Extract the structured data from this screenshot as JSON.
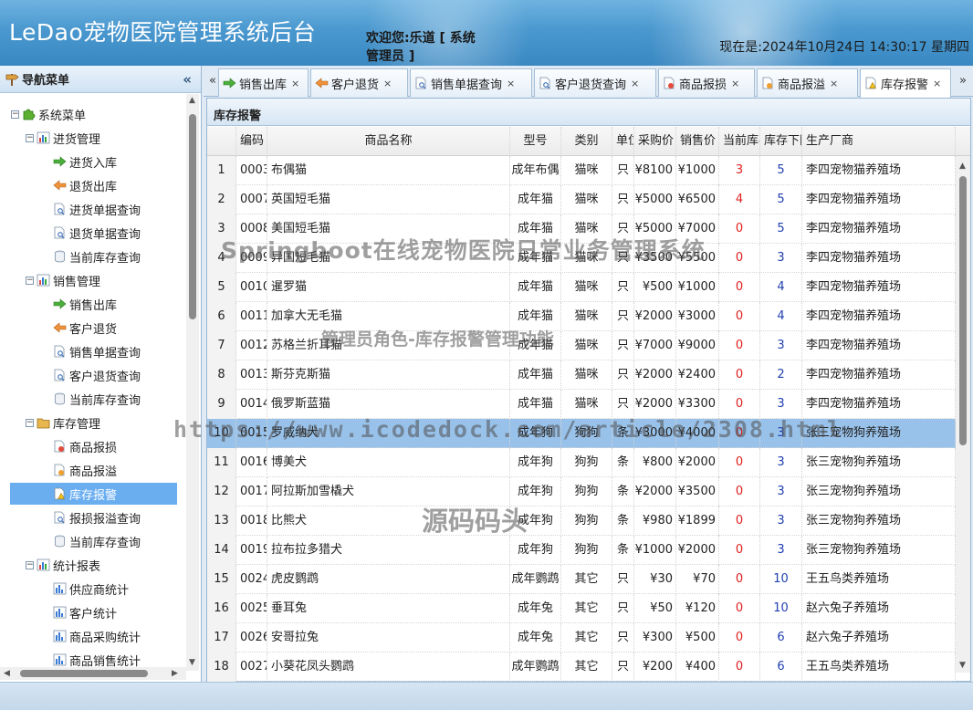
{
  "header": {
    "app_title": "LeDao宠物医院管理系统后台",
    "welcome": "欢迎您:乐道 [ 系统管理员 ]",
    "datetime": "现在是:2024年10月24日 14:30:17 星期四"
  },
  "sidebar": {
    "title": "导航菜单",
    "collapse_icon": "«",
    "root": "系统菜单",
    "groups": [
      {
        "label": "进货管理",
        "items": [
          "进货入库",
          "退货出库",
          "进货单据查询",
          "退货单据查询",
          "当前库存查询"
        ]
      },
      {
        "label": "销售管理",
        "items": [
          "销售出库",
          "客户退货",
          "销售单据查询",
          "客户退货查询",
          "当前库存查询"
        ]
      },
      {
        "label": "库存管理",
        "items": [
          "商品报损",
          "商品报溢",
          "库存报警",
          "报损报溢查询",
          "当前库存查询"
        ]
      },
      {
        "label": "统计报表",
        "items": [
          "供应商统计",
          "客户统计",
          "商品采购统计",
          "商品销售统计"
        ]
      }
    ],
    "selected_item": "库存报警"
  },
  "tabs": {
    "items": [
      "销售出库",
      "客户退货",
      "销售单据查询",
      "客户退货查询",
      "商品报损",
      "商品报溢",
      "库存报警"
    ],
    "active": "库存报警",
    "close_glyph": "×",
    "prev_glyph": "«",
    "next_glyph": "»"
  },
  "panel": {
    "title": "库存报警",
    "columns": [
      "编码",
      "商品名称",
      "型号",
      "类别",
      "单位",
      "采购价",
      "销售价",
      "当前库存",
      "库存下限",
      "生产厂商"
    ],
    "rows": [
      [
        "1",
        "0003",
        "布偶猫",
        "成年布偶",
        "猫咪",
        "只",
        "¥8100",
        "¥1000",
        "3",
        "5",
        "李四宠物猫养殖场"
      ],
      [
        "2",
        "0007",
        "英国短毛猫",
        "成年猫",
        "猫咪",
        "只",
        "¥5000",
        "¥6500",
        "4",
        "5",
        "李四宠物猫养殖场"
      ],
      [
        "3",
        "0008",
        "美国短毛猫",
        "成年猫",
        "猫咪",
        "只",
        "¥5000",
        "¥7000",
        "0",
        "5",
        "李四宠物猫养殖场"
      ],
      [
        "4",
        "0009",
        "异国短毛猫",
        "成年猫",
        "猫咪",
        "只",
        "¥3500",
        "¥5500",
        "0",
        "3",
        "李四宠物猫养殖场"
      ],
      [
        "5",
        "0010",
        "暹罗猫",
        "成年猫",
        "猫咪",
        "只",
        "¥500",
        "¥1000",
        "0",
        "4",
        "李四宠物猫养殖场"
      ],
      [
        "6",
        "0011",
        "加拿大无毛猫",
        "成年猫",
        "猫咪",
        "只",
        "¥2000",
        "¥3000",
        "0",
        "4",
        "李四宠物猫养殖场"
      ],
      [
        "7",
        "0012",
        "苏格兰折耳猫",
        "成年猫",
        "猫咪",
        "只",
        "¥7000",
        "¥9000",
        "0",
        "3",
        "李四宠物猫养殖场"
      ],
      [
        "8",
        "0013",
        "斯芬克斯猫",
        "成年猫",
        "猫咪",
        "只",
        "¥2000",
        "¥2400",
        "0",
        "2",
        "李四宠物猫养殖场"
      ],
      [
        "9",
        "0014",
        "俄罗斯蓝猫",
        "成年猫",
        "猫咪",
        "只",
        "¥2000",
        "¥3300",
        "0",
        "3",
        "李四宠物猫养殖场"
      ],
      [
        "10",
        "0015",
        "罗威纳犬",
        "成年狗",
        "狗狗",
        "条",
        "¥3000",
        "¥4000",
        "0",
        "3",
        "张三宠物狗养殖场"
      ],
      [
        "11",
        "0016",
        "博美犬",
        "成年狗",
        "狗狗",
        "条",
        "¥800",
        "¥2000",
        "0",
        "3",
        "张三宠物狗养殖场"
      ],
      [
        "12",
        "0017",
        "阿拉斯加雪橇犬",
        "成年狗",
        "狗狗",
        "条",
        "¥2000",
        "¥3500",
        "0",
        "3",
        "张三宠物狗养殖场"
      ],
      [
        "13",
        "0018",
        "比熊犬",
        "成年狗",
        "狗狗",
        "条",
        "¥980",
        "¥1899",
        "0",
        "3",
        "张三宠物狗养殖场"
      ],
      [
        "14",
        "0019",
        "拉布拉多猎犬",
        "成年狗",
        "狗狗",
        "条",
        "¥1000",
        "¥2000",
        "0",
        "3",
        "张三宠物狗养殖场"
      ],
      [
        "15",
        "0024",
        "虎皮鹦鹉",
        "成年鹦鹉",
        "其它",
        "只",
        "¥30",
        "¥70",
        "0",
        "10",
        "王五鸟类养殖场"
      ],
      [
        "16",
        "0025",
        "垂耳兔",
        "成年兔",
        "其它",
        "只",
        "¥50",
        "¥120",
        "0",
        "10",
        "赵六兔子养殖场"
      ],
      [
        "17",
        "0026",
        "安哥拉兔",
        "成年兔",
        "其它",
        "只",
        "¥300",
        "¥500",
        "0",
        "6",
        "赵六兔子养殖场"
      ],
      [
        "18",
        "0027",
        "小葵花凤头鹦鹉",
        "成年鹦鹉",
        "其它",
        "只",
        "¥200",
        "¥400",
        "0",
        "6",
        "王五鸟类养殖场"
      ]
    ],
    "selected_row": 10
  },
  "watermarks": {
    "line1": "Springboot在线宠物医院日常业务管理系统",
    "line2": "管理员角色-库存报警管理功能",
    "line3": "https://www.icodedock.com/article/2308.html",
    "line4": "源码码头"
  },
  "colors": {
    "header_blue": "#4a98cf",
    "selected_bg": "#99c2ea",
    "sidebar_selected": "#6aaef0",
    "low_stock_red": "#e02020",
    "limit_blue": "#1f3fb0"
  }
}
